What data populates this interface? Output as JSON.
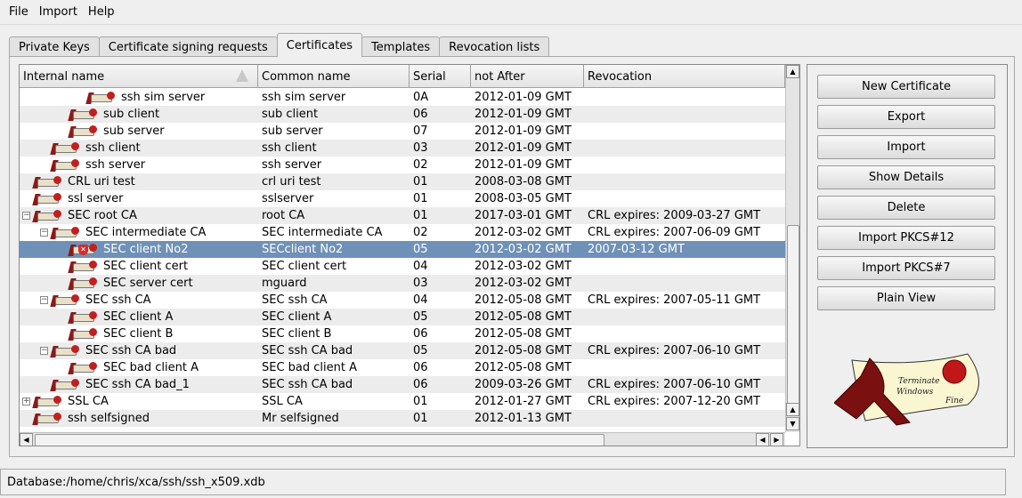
{
  "menu": [
    "File",
    "Import",
    "Help"
  ],
  "tabs": [
    "Private Keys",
    "Certificate signing requests",
    "Certificates",
    "Templates",
    "Revocation lists"
  ],
  "active_tab": 2,
  "columns": [
    "Internal name",
    "Common name",
    "Serial",
    "not After",
    "Revocation"
  ],
  "rows": [
    {
      "name": "ssh sim server",
      "cn": "ssh sim server",
      "serial": "0A",
      "after": "2012-01-09 GMT",
      "rev": "",
      "depth": 4
    },
    {
      "name": "sub client",
      "cn": "sub client",
      "serial": "06",
      "after": "2012-01-09 GMT",
      "rev": "",
      "depth": 3
    },
    {
      "name": "sub server",
      "cn": "sub server",
      "serial": "07",
      "after": "2012-01-09 GMT",
      "rev": "",
      "depth": 3
    },
    {
      "name": "ssh client",
      "cn": "ssh client",
      "serial": "03",
      "after": "2012-01-09 GMT",
      "rev": "",
      "depth": 2
    },
    {
      "name": "ssh server",
      "cn": "ssh server",
      "serial": "02",
      "after": "2012-01-09 GMT",
      "rev": "",
      "depth": 2
    },
    {
      "name": "CRL uri test",
      "cn": "crl uri test",
      "serial": "01",
      "after": "2008-03-08 GMT",
      "rev": "",
      "depth": 1
    },
    {
      "name": "ssl server",
      "cn": "sslserver",
      "serial": "01",
      "after": "2008-03-05 GMT",
      "rev": "",
      "depth": 1
    },
    {
      "name": "SEC root CA",
      "cn": "root CA",
      "serial": "01",
      "after": "2017-03-01 GMT",
      "rev": "CRL expires: 2009-03-27 GMT",
      "depth": 1,
      "exp": "-"
    },
    {
      "name": "SEC intermediate CA",
      "cn": "SEC intermediate CA",
      "serial": "02",
      "after": "2012-03-02 GMT",
      "rev": "CRL expires: 2007-06-09 GMT",
      "depth": 2,
      "exp": "-"
    },
    {
      "name": "SEC client No2",
      "cn": "SECclient No2",
      "serial": "05",
      "after": "2012-03-02 GMT",
      "rev": "2007-03-12 GMT",
      "depth": 3,
      "revoked": true,
      "selected": true
    },
    {
      "name": "SEC client cert",
      "cn": "SEC client cert",
      "serial": "04",
      "after": "2012-03-02 GMT",
      "rev": "",
      "depth": 3
    },
    {
      "name": "SEC server cert",
      "cn": "mguard",
      "serial": "03",
      "after": "2012-03-02 GMT",
      "rev": "",
      "depth": 3
    },
    {
      "name": "SEC ssh CA",
      "cn": "SEC ssh CA",
      "serial": "04",
      "after": "2012-05-08 GMT",
      "rev": "CRL expires: 2007-05-11 GMT",
      "depth": 2,
      "exp": "-"
    },
    {
      "name": "SEC client A",
      "cn": "SEC client A",
      "serial": "05",
      "after": "2012-05-08 GMT",
      "rev": "",
      "depth": 3
    },
    {
      "name": "SEC client B",
      "cn": "SEC client B",
      "serial": "06",
      "after": "2012-05-08 GMT",
      "rev": "",
      "depth": 3
    },
    {
      "name": "SEC ssh CA bad",
      "cn": "SEC ssh CA bad",
      "serial": "05",
      "after": "2012-05-08 GMT",
      "rev": "CRL expires: 2007-06-10 GMT",
      "depth": 2,
      "exp": "-"
    },
    {
      "name": "SEC bad client A",
      "cn": "SEC bad client A",
      "serial": "06",
      "after": "2012-05-08 GMT",
      "rev": "",
      "depth": 3
    },
    {
      "name": "SEC ssh CA bad_1",
      "cn": "SEC ssh CA bad",
      "serial": "06",
      "after": "2009-03-26 GMT",
      "rev": "CRL expires: 2007-06-10 GMT",
      "depth": 2
    },
    {
      "name": "SSL CA",
      "cn": "SSL CA",
      "serial": "01",
      "after": "2012-01-27 GMT",
      "rev": "CRL expires: 2007-12-20 GMT",
      "depth": 1,
      "exp": "+"
    },
    {
      "name": "ssh selfsigned",
      "cn": "Mr selfsigned",
      "serial": "01",
      "after": "2012-01-13 GMT",
      "rev": "",
      "depth": 1
    }
  ],
  "buttons": [
    "New Certificate",
    "Export",
    "Import",
    "Show Details",
    "Delete",
    "Import PKCS#12",
    "Import PKCS#7",
    "Plain View"
  ],
  "logo_text": "Terminate Windows Fine",
  "status": "Database:/home/chris/xca/ssh/ssh_x509.xdb",
  "colors": {
    "selection": "#6f91b7",
    "accent": "#8a1a1a"
  }
}
